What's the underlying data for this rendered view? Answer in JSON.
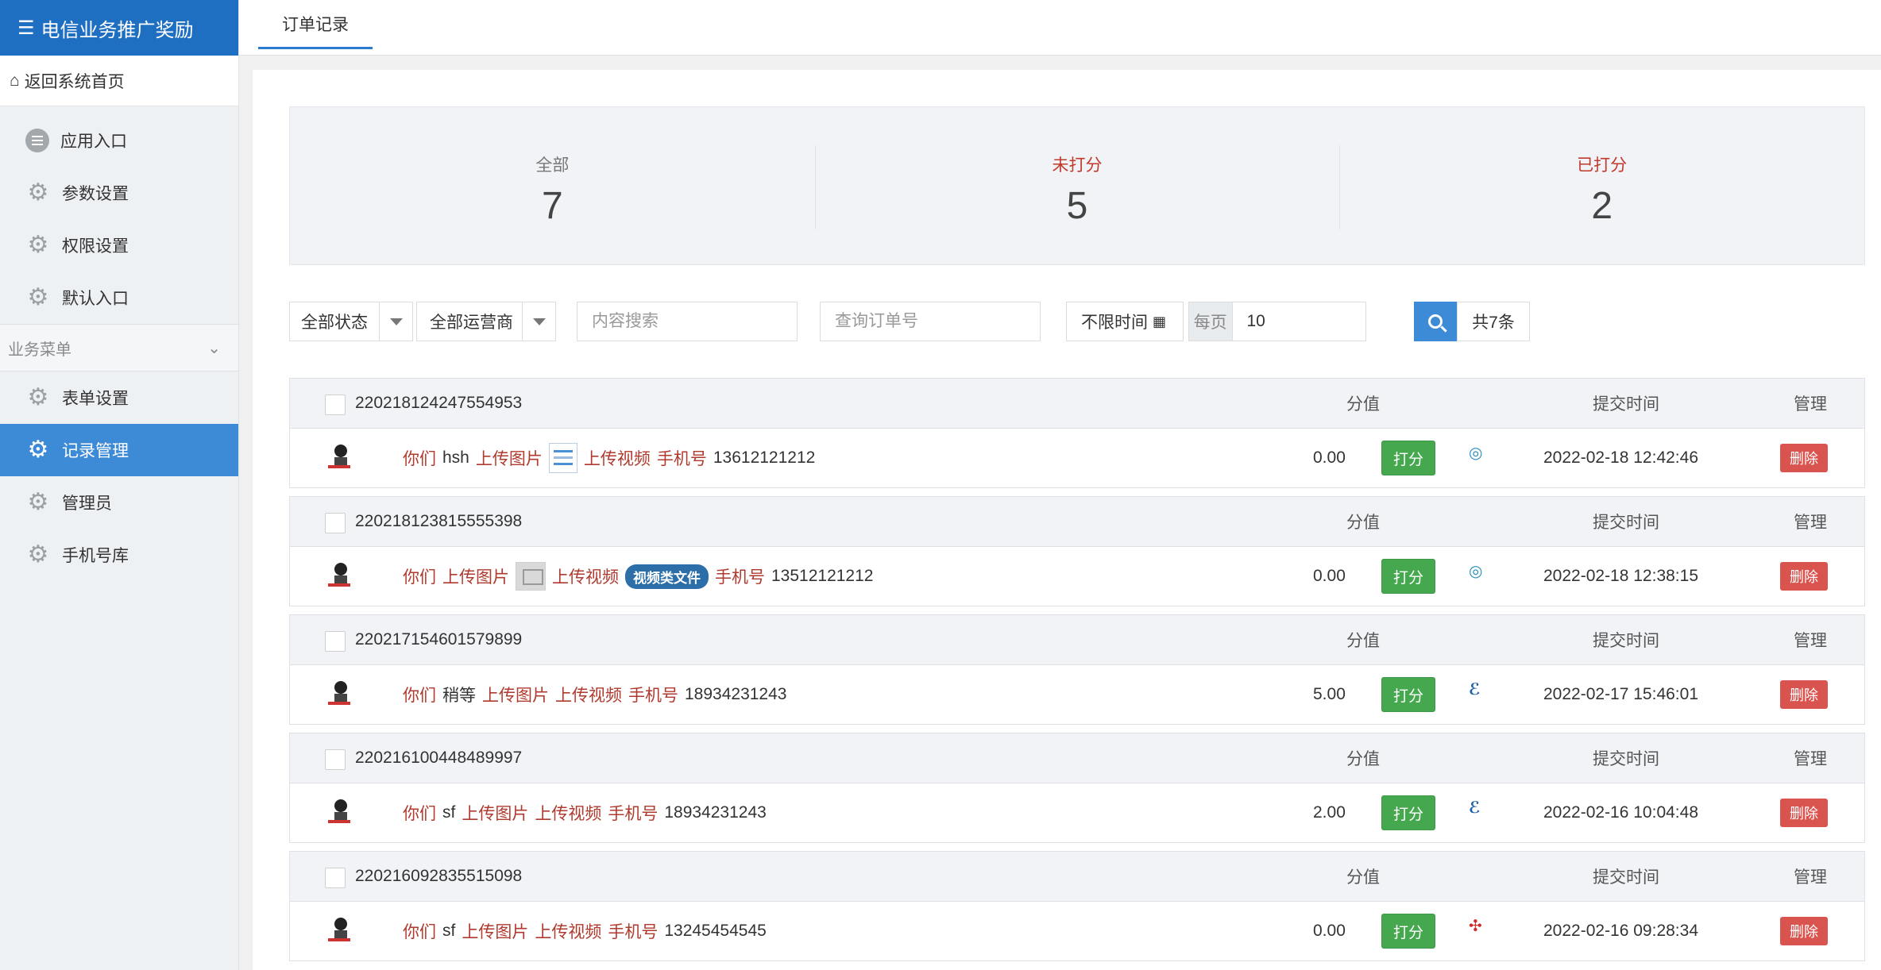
{
  "sidebar": {
    "title": "电信业务推广奖励",
    "home": "返回系统首页",
    "items_top": [
      {
        "label": "应用入口",
        "icon": "chat-icon"
      },
      {
        "label": "参数设置",
        "icon": "gear-icon"
      },
      {
        "label": "权限设置",
        "icon": "gear-icon"
      },
      {
        "label": "默认入口",
        "icon": "gear-icon"
      }
    ],
    "group_label": "业务菜单",
    "items_group": [
      {
        "label": "表单设置",
        "icon": "gear-icon"
      },
      {
        "label": "记录管理",
        "icon": "gear-icon",
        "active": true
      },
      {
        "label": "管理员",
        "icon": "gear-icon"
      },
      {
        "label": "手机号库",
        "icon": "gear-icon"
      }
    ]
  },
  "topbar": {
    "tab": "订单记录"
  },
  "stats": {
    "all_label": "全部",
    "all_value": "7",
    "unscored_label": "未打分",
    "unscored_value": "5",
    "scored_label": "已打分",
    "scored_value": "2"
  },
  "filters": {
    "status": "全部状态",
    "carrier": "全部运营商",
    "content_placeholder": "内容搜索",
    "order_placeholder": "查询订单号",
    "time": "不限时间",
    "perpage_label": "每页",
    "perpage_value": "10",
    "total": "共7条"
  },
  "table_headers": {
    "score": "分值",
    "time": "提交时间",
    "manage": "管理"
  },
  "labels": {
    "you": "你们",
    "upload_image": "上传图片",
    "upload_video": "上传视频",
    "phone": "手机号",
    "video_badge": "视频类文件",
    "score_btn": "打分",
    "delete_btn": "删除"
  },
  "orders": [
    {
      "no": "220218124247554953",
      "text": "hsh",
      "phone": "13612121212",
      "score": "0.00",
      "time": "2022-02-18 12:42:46",
      "carrier": "mobile"
    },
    {
      "no": "220218123815555398",
      "text": "",
      "phone": "13512121212",
      "score": "0.00",
      "time": "2022-02-18 12:38:15",
      "carrier": "mobile"
    },
    {
      "no": "220217154601579899",
      "text": "稍等",
      "phone": "18934231243",
      "score": "5.00",
      "time": "2022-02-17 15:46:01",
      "carrier": "telecom"
    },
    {
      "no": "220216100448489997",
      "text": "sf",
      "phone": "18934231243",
      "score": "2.00",
      "time": "2022-02-16 10:04:48",
      "carrier": "telecom"
    },
    {
      "no": "220216092835515098",
      "text": "sf",
      "phone": "13245454545",
      "score": "0.00",
      "time": "2022-02-16 09:28:34",
      "carrier": "unicom"
    }
  ]
}
